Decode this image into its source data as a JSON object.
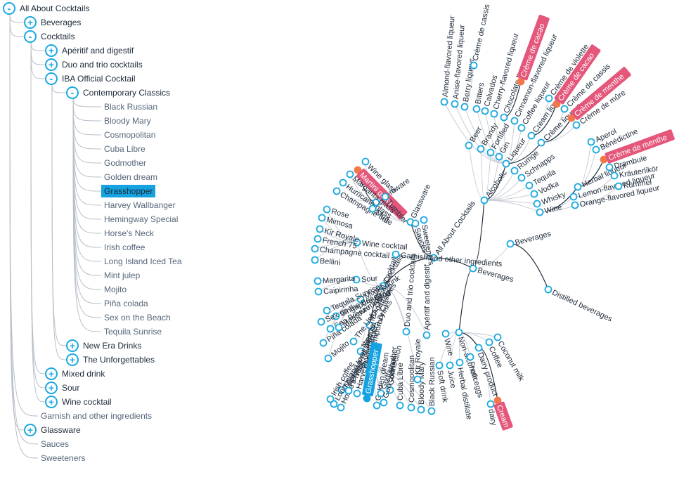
{
  "colors": {
    "accent": "#1aa9e0",
    "highlight": "#e4567a",
    "highlight_dot": "#f2784b",
    "selected": "#14a3e0",
    "text": "#1e2b3a",
    "leaf_text": "#56667a",
    "link": "#c9ced6",
    "link_active": "#1e2b3a"
  },
  "icons": {
    "expand": "+",
    "collapse": "-"
  },
  "left_tree": {
    "nodes": [
      {
        "label": "All About Cocktails",
        "depth": 0,
        "toggle": "collapse"
      },
      {
        "label": "Beverages",
        "depth": 1,
        "toggle": "expand"
      },
      {
        "label": "Cocktails",
        "depth": 1,
        "toggle": "collapse"
      },
      {
        "label": "Apéritif and digestif",
        "depth": 2,
        "toggle": "expand"
      },
      {
        "label": "Duo and trio cocktails",
        "depth": 2,
        "toggle": "expand"
      },
      {
        "label": "IBA Official Cocktail",
        "depth": 2,
        "toggle": "collapse"
      },
      {
        "label": "Contemporary Classics",
        "depth": 3,
        "toggle": "collapse"
      },
      {
        "label": "Black Russian",
        "depth": 4,
        "toggle": null
      },
      {
        "label": "Bloody Mary",
        "depth": 4,
        "toggle": null
      },
      {
        "label": "Cosmopolitan",
        "depth": 4,
        "toggle": null
      },
      {
        "label": "Cuba Libre",
        "depth": 4,
        "toggle": null
      },
      {
        "label": "Godmother",
        "depth": 4,
        "toggle": null
      },
      {
        "label": "Golden dream",
        "depth": 4,
        "toggle": null
      },
      {
        "label": "Grasshopper",
        "depth": 4,
        "toggle": null,
        "selected": true
      },
      {
        "label": "Harvey Wallbanger",
        "depth": 4,
        "toggle": null
      },
      {
        "label": "Hemingway Special",
        "depth": 4,
        "toggle": null
      },
      {
        "label": "Horse's Neck",
        "depth": 4,
        "toggle": null
      },
      {
        "label": "Irish coffee",
        "depth": 4,
        "toggle": null
      },
      {
        "label": "Long Island Iced Tea",
        "depth": 4,
        "toggle": null
      },
      {
        "label": "Mint julep",
        "depth": 4,
        "toggle": null
      },
      {
        "label": "Mojito",
        "depth": 4,
        "toggle": null
      },
      {
        "label": "Piña colada",
        "depth": 4,
        "toggle": null
      },
      {
        "label": "Sex on the Beach",
        "depth": 4,
        "toggle": null
      },
      {
        "label": "Tequila Sunrise",
        "depth": 4,
        "toggle": null
      },
      {
        "label": "New Era Drinks",
        "depth": 3,
        "toggle": "expand"
      },
      {
        "label": "The Unforgettables",
        "depth": 3,
        "toggle": "expand"
      },
      {
        "label": "Mixed drink",
        "depth": 2,
        "toggle": "expand"
      },
      {
        "label": "Sour",
        "depth": 2,
        "toggle": "expand"
      },
      {
        "label": "Wine cocktail",
        "depth": 2,
        "toggle": "expand"
      },
      {
        "label": "Garnish and other ingredients",
        "depth": 1,
        "toggle": null
      },
      {
        "label": "Glassware",
        "depth": 1,
        "toggle": "expand"
      },
      {
        "label": "Sauces",
        "depth": 1,
        "toggle": null
      },
      {
        "label": "Sweeteners",
        "depth": 1,
        "toggle": null
      }
    ]
  },
  "radial_tree": {
    "nodes": [
      {
        "label": "All About Cocktails",
        "type": "node"
      },
      {
        "label": "Beverages",
        "type": "node"
      },
      {
        "label": "Beverages",
        "type": "node"
      },
      {
        "label": "Alcoholic",
        "type": "node"
      },
      {
        "label": "Beer",
        "type": "node"
      },
      {
        "label": "Brandy",
        "type": "node"
      },
      {
        "label": "Fortified",
        "type": "node"
      },
      {
        "label": "Gin",
        "type": "node"
      },
      {
        "label": "Liqueur",
        "type": "node"
      },
      {
        "label": "Rumge",
        "type": "node"
      },
      {
        "label": "Schnapps",
        "type": "node"
      },
      {
        "label": "Tequila",
        "type": "node"
      },
      {
        "label": "Vodka",
        "type": "node"
      },
      {
        "label": "Whisky",
        "type": "node"
      },
      {
        "label": "Wine",
        "type": "node"
      },
      {
        "label": "Almond-flavored liqueur",
        "type": "node"
      },
      {
        "label": "Anise-flavored liqueur",
        "type": "node"
      },
      {
        "label": "Berry liqueur",
        "type": "node"
      },
      {
        "label": "Crème de cassis",
        "type": "node"
      },
      {
        "label": "Bitters",
        "type": "node"
      },
      {
        "label": "Calvados",
        "type": "node"
      },
      {
        "label": "Cherry-flavored liqueur",
        "type": "node"
      },
      {
        "label": "Chocolate liqueur",
        "type": "node"
      },
      {
        "label": "Crème de cacao",
        "type": "highlight"
      },
      {
        "label": "Cinnamon-flavored liqueur",
        "type": "node"
      },
      {
        "label": "Coffee liqueur",
        "type": "node"
      },
      {
        "label": "Cream liqueur",
        "type": "node"
      },
      {
        "label": "Crème de violette",
        "type": "node"
      },
      {
        "label": "Crème de cacao",
        "type": "highlight"
      },
      {
        "label": "Crème liqueur",
        "type": "node"
      },
      {
        "label": "Crème de cassis",
        "type": "node"
      },
      {
        "label": "Crème de menthe",
        "type": "highlight"
      },
      {
        "label": "Crème de mûre",
        "type": "node"
      },
      {
        "label": "Herbal liqueur",
        "type": "node"
      },
      {
        "label": "Aperol",
        "type": "node"
      },
      {
        "label": "Bénédictine",
        "type": "node"
      },
      {
        "label": "Crème de menthe",
        "type": "highlight"
      },
      {
        "label": "Drambuie",
        "type": "node"
      },
      {
        "label": "Lemon-flavored liqueur",
        "type": "node"
      },
      {
        "label": "Kräuterlikör",
        "type": "node"
      },
      {
        "label": "Orange-flavored liqueur",
        "type": "node"
      },
      {
        "label": "Kümmel",
        "type": "node"
      },
      {
        "label": "Distilled beverages",
        "type": "node"
      },
      {
        "label": "Non-alcoholic",
        "type": "node"
      },
      {
        "label": "Wine",
        "type": "node"
      },
      {
        "label": "Soft drink",
        "type": "node"
      },
      {
        "label": "Juice",
        "type": "node"
      },
      {
        "label": "Herbal distillate",
        "type": "node"
      },
      {
        "label": "From eggs",
        "type": "node"
      },
      {
        "label": "Dairy product",
        "type": "node"
      },
      {
        "label": "dairy",
        "type": "node"
      },
      {
        "label": "Cream",
        "type": "highlight"
      },
      {
        "label": "Coffee",
        "type": "node"
      },
      {
        "label": "Coconut milk",
        "type": "node"
      },
      {
        "label": "Cocktails",
        "type": "node"
      },
      {
        "label": "Glassware",
        "type": "node"
      },
      {
        "label": "Stemware",
        "type": "node"
      },
      {
        "label": "Martini glass",
        "type": "highlight"
      },
      {
        "label": "Wine glass",
        "type": "node"
      },
      {
        "label": "Margarita glass",
        "type": "node"
      },
      {
        "label": "Hurricane glass",
        "type": "node"
      },
      {
        "label": "Champagne flute",
        "type": "node"
      },
      {
        "label": "Tumbler",
        "type": "node"
      },
      {
        "label": "Mug",
        "type": "node"
      },
      {
        "label": "Sauces",
        "type": "node"
      },
      {
        "label": "Sweeteners",
        "type": "node"
      },
      {
        "label": "Garnish and other ingredients",
        "type": "node"
      },
      {
        "label": "Wine cocktail",
        "type": "node"
      },
      {
        "label": "Rose",
        "type": "node"
      },
      {
        "label": "Mimosa",
        "type": "node"
      },
      {
        "label": "Kir Royale",
        "type": "node"
      },
      {
        "label": "French 75",
        "type": "node"
      },
      {
        "label": "Champagne cocktail",
        "type": "node"
      },
      {
        "label": "Bellini",
        "type": "node"
      },
      {
        "label": "Sour",
        "type": "node"
      },
      {
        "label": "Margarita",
        "type": "node"
      },
      {
        "label": "Caipirinha",
        "type": "node"
      },
      {
        "label": "Mixed drink",
        "type": "node"
      },
      {
        "label": "Tequila Sunrise",
        "type": "node"
      },
      {
        "label": "Singapore Sling",
        "type": "node"
      },
      {
        "label": "Sex on the Beach",
        "type": "node"
      },
      {
        "label": "Sea Breeze",
        "type": "node"
      },
      {
        "label": "Piña colada",
        "type": "node"
      },
      {
        "label": "Moscow mule",
        "type": "node"
      },
      {
        "label": "Mojito",
        "type": "node"
      },
      {
        "label": "IBA Official Cocktail",
        "type": "node"
      },
      {
        "label": "The Unforgettables",
        "type": "node"
      },
      {
        "label": "New Era Drinks",
        "type": "node"
      },
      {
        "label": "Contemporary Classics",
        "type": "node"
      },
      {
        "label": "Mint julep",
        "type": "node"
      },
      {
        "label": "Long Island Iced Tea",
        "type": "node"
      },
      {
        "label": "Irish coffee",
        "type": "node"
      },
      {
        "label": "Horse's Neck",
        "type": "node"
      },
      {
        "label": "Hemingway Special",
        "type": "node"
      },
      {
        "label": "Harvey Wallbanger",
        "type": "node"
      },
      {
        "label": "Grasshopper",
        "type": "selected"
      },
      {
        "label": "Golden dream",
        "type": "node"
      },
      {
        "label": "Godmother",
        "type": "node"
      },
      {
        "label": "Godfather",
        "type": "node"
      },
      {
        "label": "Gun connection",
        "type": "node"
      },
      {
        "label": "Cuba Libre",
        "type": "node"
      },
      {
        "label": "Cosmopolitan",
        "type": "node"
      },
      {
        "label": "Bloody Mary",
        "type": "node"
      },
      {
        "label": "Black Russian",
        "type": "node"
      },
      {
        "label": "Kir Royale",
        "type": "node"
      },
      {
        "label": "Duo and trio cocktails",
        "type": "node"
      },
      {
        "label": "Apéritif and digestif",
        "type": "node"
      }
    ]
  }
}
